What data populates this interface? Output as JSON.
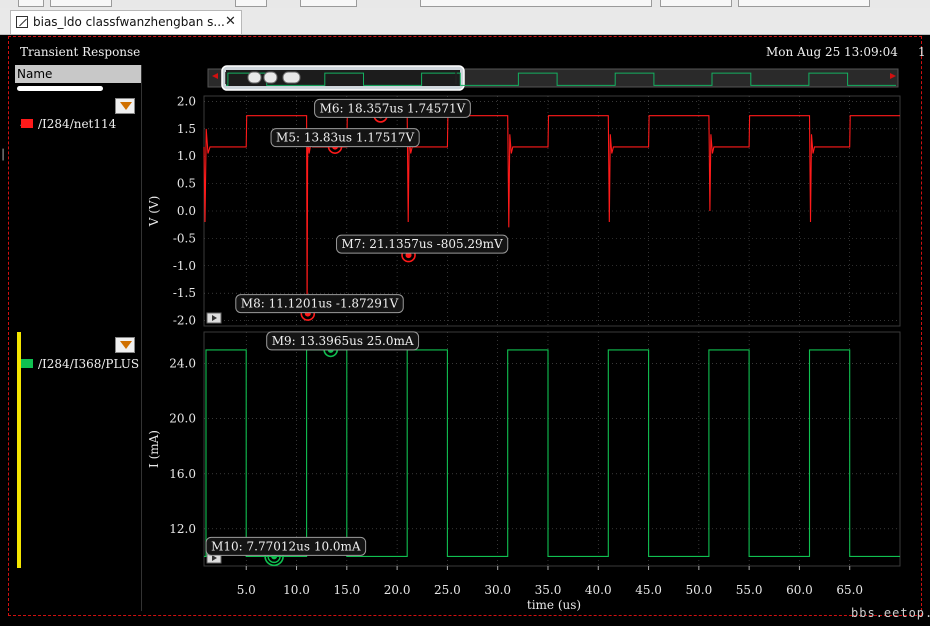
{
  "window": {
    "tab_title": "bias_ldo classfwanzhengban s...",
    "tab_close": "✕",
    "title": "Transient Response",
    "date": "Mon Aug 25 13:09:04",
    "edge_char": "1"
  },
  "legend": {
    "header": "Name",
    "items": [
      {
        "label": "/I284/net114",
        "color": "#ff1a1a"
      },
      {
        "label": "/I284/I368/PLUS",
        "color": "#10c050"
      }
    ]
  },
  "watermark": "bbs.eetop.cn",
  "chart_data": [
    {
      "type": "line",
      "ylabel": "V (V)",
      "ylim": [
        -2.1,
        2.1
      ],
      "yticks": [
        "2.0",
        "1.5",
        "1.0",
        "0.5",
        "0.0",
        "-0.5",
        "-1.0",
        "-1.5",
        "-2.0"
      ],
      "ytick_values": [
        2.0,
        1.5,
        1.0,
        0.5,
        0.0,
        -0.5,
        -1.0,
        -1.5,
        -2.0
      ],
      "xlim": [
        0.8,
        70.0
      ],
      "grid": true,
      "series": [
        {
          "name": "/I284/net114",
          "color": "#ff1a1a",
          "x": [
            0.8,
            0.9,
            1.0,
            1.02,
            1.1,
            1.2,
            1.4,
            5.0,
            5.05,
            5.1,
            10.9,
            11.0,
            11.05,
            11.1,
            11.15,
            11.25,
            11.4,
            11.6,
            15.0,
            15.05,
            15.1,
            20.9,
            21.0,
            21.1,
            21.2,
            21.35,
            21.5,
            25.0,
            25.05,
            25.1,
            30.9,
            31.0,
            31.1,
            31.2,
            31.35,
            31.5,
            35.0,
            35.05,
            35.1,
            40.9,
            41.0,
            41.1,
            41.2,
            41.35,
            41.5,
            45.0,
            45.05,
            45.1,
            50.9,
            51.0,
            51.1,
            51.2,
            51.35,
            51.5,
            55.0,
            55.05,
            55.1,
            60.9,
            61.0,
            61.1,
            61.2,
            61.35,
            61.5,
            65.0,
            65.05,
            65.1,
            70.0
          ],
          "y": [
            1.17,
            -0.2,
            1.17,
            1.5,
            1.3,
            1.05,
            1.17,
            1.17,
            1.74,
            1.74,
            1.74,
            1.74,
            -1.87,
            0.9,
            1.45,
            1.05,
            1.2,
            1.17,
            1.17,
            1.74,
            1.74,
            1.74,
            1.74,
            -0.2,
            1.4,
            1.05,
            1.17,
            1.17,
            1.74,
            1.74,
            1.74,
            1.74,
            -0.3,
            1.4,
            1.05,
            1.17,
            1.17,
            1.74,
            1.74,
            1.74,
            1.74,
            -0.2,
            1.4,
            1.05,
            1.17,
            1.17,
            1.74,
            1.74,
            1.74,
            1.74,
            -0.0,
            1.4,
            1.05,
            1.17,
            1.17,
            1.74,
            1.74,
            1.74,
            1.74,
            -0.2,
            1.4,
            1.05,
            1.17,
            1.17,
            1.74,
            1.74,
            1.74
          ]
        }
      ],
      "markers": [
        {
          "id": "M6",
          "label": "M6: 18.357us 1.74571V",
          "x": 18.357,
          "y": 1.74571,
          "dx": -66,
          "dy": -16
        },
        {
          "id": "M5",
          "label": "M5: 13.83us 1.17517V",
          "x": 13.83,
          "y": 1.17517,
          "dx": -64,
          "dy": -18
        },
        {
          "id": "M7",
          "label": "M7: 21.1357us -805.29mV",
          "x": 21.1357,
          "y": -0.80529,
          "dx": -72,
          "dy": -20
        },
        {
          "id": "M8",
          "label": "M8: 11.1201us -1.87291V",
          "x": 11.1201,
          "y": -1.87291,
          "dx": -72,
          "dy": -19
        }
      ]
    },
    {
      "type": "line",
      "ylabel": "I (mA)",
      "ylim": [
        9.3,
        26.3
      ],
      "yticks": [
        "24.0",
        "20.0",
        "16.0",
        "12.0"
      ],
      "ytick_values": [
        24.0,
        20.0,
        16.0,
        12.0
      ],
      "xlim": [
        0.8,
        70.0
      ],
      "xlabel": "time (us)",
      "xticks": [
        "5.0",
        "10.0",
        "15.0",
        "20.0",
        "25.0",
        "30.0",
        "35.0",
        "40.0",
        "45.0",
        "50.0",
        "55.0",
        "60.0",
        "65.0"
      ],
      "xtick_values": [
        5,
        10,
        15,
        20,
        25,
        30,
        35,
        40,
        45,
        50,
        55,
        60,
        65
      ],
      "grid": true,
      "series": [
        {
          "name": "/I284/I368/PLUS",
          "color": "#10c050",
          "x": [
            0.8,
            1.0,
            1.0,
            5.0,
            5.0,
            11.0,
            11.0,
            15.0,
            15.0,
            21.0,
            21.0,
            25.0,
            25.0,
            31.0,
            31.0,
            35.0,
            35.0,
            41.0,
            41.0,
            45.0,
            45.0,
            51.0,
            51.0,
            55.0,
            55.0,
            61.0,
            61.0,
            65.0,
            65.0,
            70.0
          ],
          "y": [
            10.0,
            10.0,
            25.0,
            25.0,
            10.0,
            10.0,
            25.0,
            25.0,
            10.0,
            10.0,
            25.0,
            25.0,
            10.0,
            10.0,
            25.0,
            25.0,
            10.0,
            10.0,
            25.0,
            25.0,
            10.0,
            10.0,
            25.0,
            25.0,
            10.0,
            10.0,
            25.0,
            25.0,
            10.0,
            10.0
          ]
        }
      ],
      "markers": [
        {
          "id": "M9",
          "label": "M9: 13.3965us 25.0mA",
          "x": 13.3965,
          "y": 25.0,
          "dx": -64,
          "dy": -18
        },
        {
          "id": "M10",
          "label": "M10: 7.77012us 10.0mA",
          "x": 7.77012,
          "y": 10.0,
          "dx": -68,
          "dy": -19
        }
      ]
    }
  ]
}
